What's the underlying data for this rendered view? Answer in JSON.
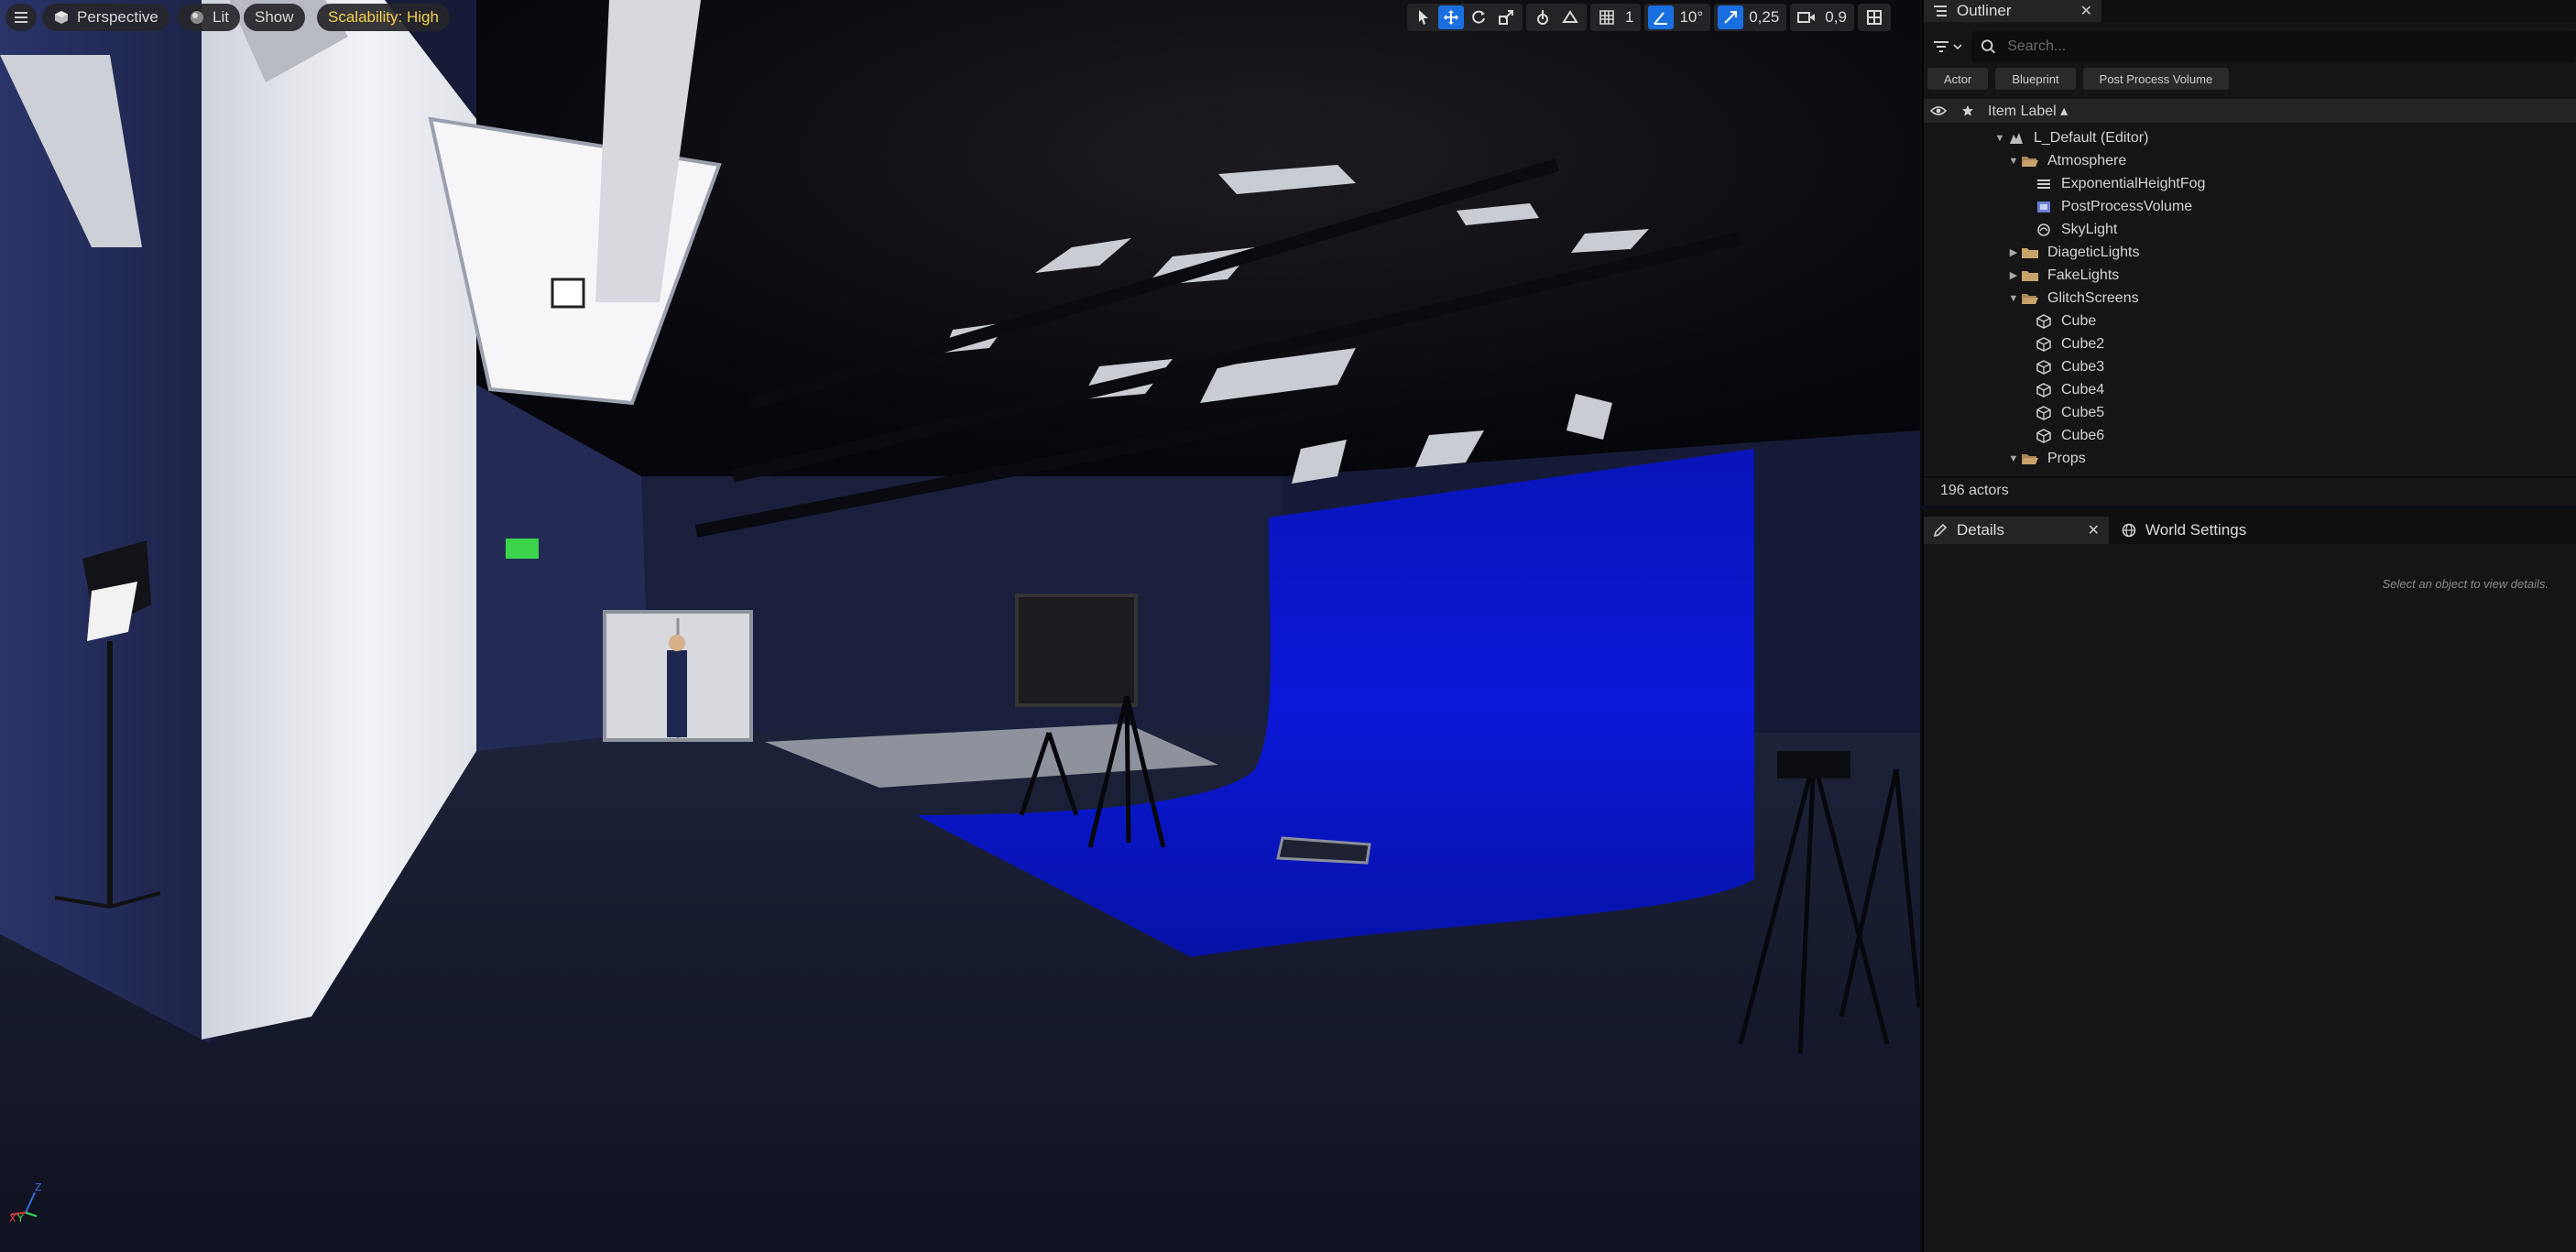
{
  "viewport": {
    "menu_icon": "hamburger-icon",
    "view_mode_label": "Perspective",
    "lighting_label": "Lit",
    "show_label": "Show",
    "scalability_label": "Scalability: High",
    "toolbar": {
      "grid_snap_value": "1",
      "rotation_snap_value": "10°",
      "scale_snap_value": "0,25",
      "camera_speed_value": "0,9"
    },
    "axis": {
      "z": "Z",
      "x": "X",
      "y": "Y"
    }
  },
  "outliner": {
    "tab_label": "Outliner",
    "close_glyph": "✕",
    "search_placeholder": "Search...",
    "filter_chips": [
      "Actor",
      "Blueprint",
      "Post Process Volume"
    ],
    "column_header": "Item Label ▴",
    "items": [
      {
        "label": "L_Default (Editor)",
        "depth": 0,
        "arrow": "▼",
        "icon": "level-icon"
      },
      {
        "label": "Atmosphere",
        "depth": 1,
        "arrow": "▼",
        "icon": "folder-open-icon"
      },
      {
        "label": "ExponentialHeightFog",
        "depth": 2,
        "arrow": "",
        "icon": "fog-icon"
      },
      {
        "label": "PostProcessVolume",
        "depth": 2,
        "arrow": "",
        "icon": "post-process-icon"
      },
      {
        "label": "SkyLight",
        "depth": 2,
        "arrow": "",
        "icon": "skylight-icon"
      },
      {
        "label": "DiageticLights",
        "depth": 1,
        "arrow": "▶",
        "icon": "folder-icon"
      },
      {
        "label": "FakeLights",
        "depth": 1,
        "arrow": "▶",
        "icon": "folder-icon"
      },
      {
        "label": "GlitchScreens",
        "depth": 1,
        "arrow": "▼",
        "icon": "folder-open-icon"
      },
      {
        "label": "Cube",
        "depth": 2,
        "arrow": "",
        "icon": "static-mesh-icon"
      },
      {
        "label": "Cube2",
        "depth": 2,
        "arrow": "",
        "icon": "static-mesh-icon"
      },
      {
        "label": "Cube3",
        "depth": 2,
        "arrow": "",
        "icon": "static-mesh-icon"
      },
      {
        "label": "Cube4",
        "depth": 2,
        "arrow": "",
        "icon": "static-mesh-icon"
      },
      {
        "label": "Cube5",
        "depth": 2,
        "arrow": "",
        "icon": "static-mesh-icon"
      },
      {
        "label": "Cube6",
        "depth": 2,
        "arrow": "",
        "icon": "static-mesh-icon"
      },
      {
        "label": "Props",
        "depth": 1,
        "arrow": "▼",
        "icon": "folder-open-icon"
      }
    ],
    "actor_count": "196 actors"
  },
  "details": {
    "tab_label": "Details",
    "world_settings_label": "World Settings",
    "close_glyph": "✕",
    "empty_message": "Select an object to view details."
  },
  "colors": {
    "accent": "#1a6fe0",
    "scalability_text": "#f4d14a",
    "green_screen": "#0a14d6",
    "folder": "#c9a46a"
  }
}
